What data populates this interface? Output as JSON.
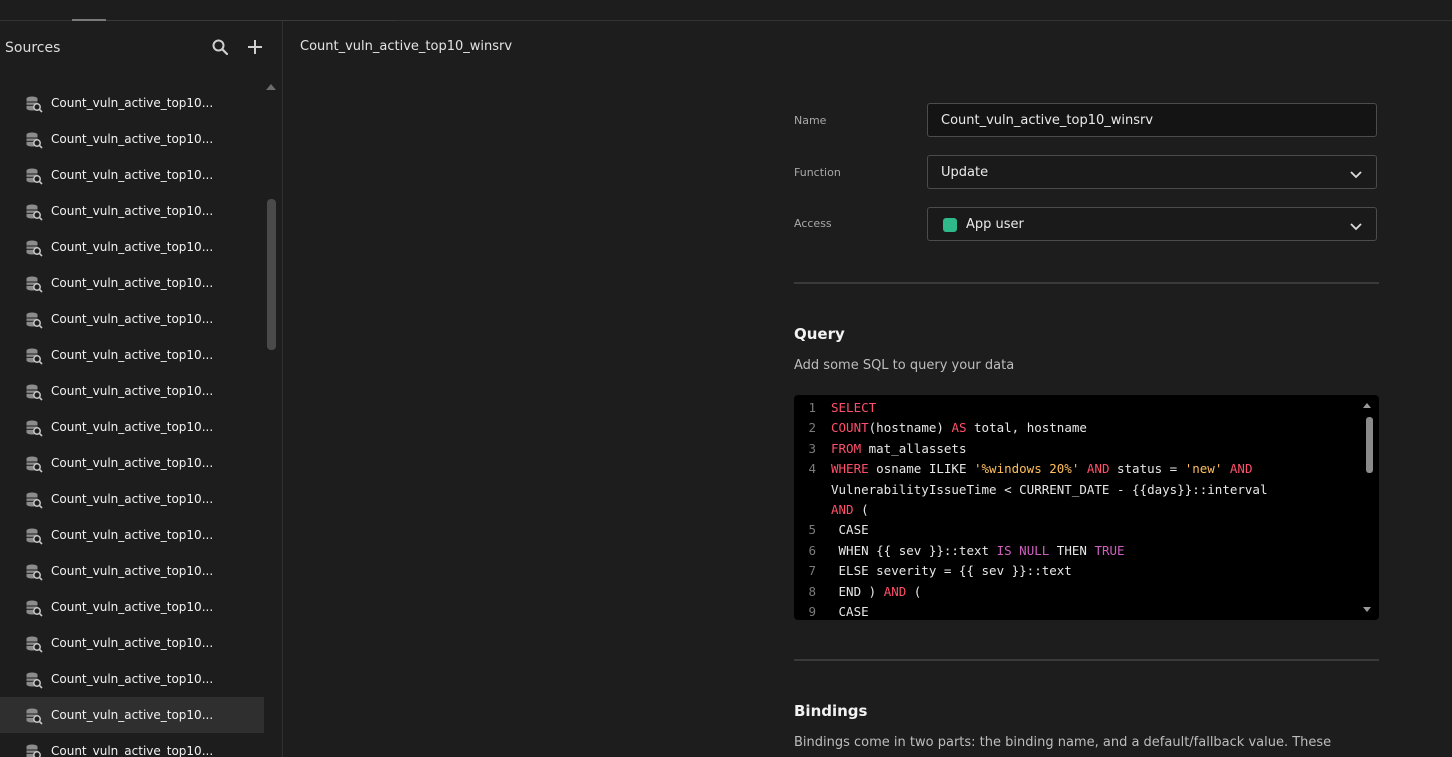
{
  "sidebar": {
    "title": "Sources",
    "search_icon": "search-icon",
    "add_icon": "plus-icon",
    "item_icon": "database-search-icon",
    "items": [
      {
        "label": "Count_vuln_active_top10..."
      },
      {
        "label": "Count_vuln_active_top10..."
      },
      {
        "label": "Count_vuln_active_top10..."
      },
      {
        "label": "Count_vuln_active_top10..."
      },
      {
        "label": "Count_vuln_active_top10..."
      },
      {
        "label": "Count_vuln_active_top10..."
      },
      {
        "label": "Count_vuln_active_top10..."
      },
      {
        "label": "Count_vuln_active_top10..."
      },
      {
        "label": "Count_vuln_active_top10..."
      },
      {
        "label": "Count_vuln_active_top10..."
      },
      {
        "label": "Count_vuln_active_top10..."
      },
      {
        "label": "Count_vuln_active_top10..."
      },
      {
        "label": "Count_vuln_active_top10..."
      },
      {
        "label": "Count_vuln_active_top10..."
      },
      {
        "label": "Count_vuln_active_top10..."
      },
      {
        "label": "Count_vuln_active_top10..."
      },
      {
        "label": "Count_vuln_active_top10..."
      },
      {
        "label": "Count_vuln_active_top10...",
        "selected": true
      },
      {
        "label": "Count_vuln_active_top10..."
      }
    ]
  },
  "header": {
    "title": "Count_vuln_active_top10_winsrv"
  },
  "form": {
    "name_label": "Name",
    "name_value": "Count_vuln_active_top10_winsrv",
    "function_label": "Function",
    "function_value": "Update",
    "access_label": "Access",
    "access_value": "App user",
    "access_color": "#2fb889"
  },
  "query": {
    "title": "Query",
    "description": "Add some SQL to query your data",
    "lines": [
      {
        "n": "1",
        "parts": [
          [
            "kw",
            "SELECT"
          ]
        ]
      },
      {
        "n": "2",
        "parts": [
          [
            "kw",
            "COUNT"
          ],
          [
            "",
            "(hostname) "
          ],
          [
            "kw",
            "AS"
          ],
          [
            "",
            " total, hostname"
          ]
        ]
      },
      {
        "n": "3",
        "parts": [
          [
            "kw",
            "FROM"
          ],
          [
            "",
            " mat_allassets"
          ]
        ]
      },
      {
        "n": "4",
        "parts": [
          [
            "kw",
            "WHERE"
          ],
          [
            "",
            " osname ILIKE "
          ],
          [
            "str",
            "'%windows 20%'"
          ],
          [
            "",
            " "
          ],
          [
            "kw",
            "AND"
          ],
          [
            "",
            " status = "
          ],
          [
            "str",
            "'new'"
          ],
          [
            "",
            " "
          ],
          [
            "kw",
            "AND"
          ]
        ]
      },
      {
        "n": "",
        "parts": [
          [
            "",
            "VulnerabilityIssueTime < CURRENT_DATE - {{days}}::interval"
          ]
        ]
      },
      {
        "n": "",
        "parts": [
          [
            "kw",
            "AND"
          ],
          [
            "",
            " ("
          ]
        ]
      },
      {
        "n": "5",
        "parts": [
          [
            "",
            " CASE"
          ]
        ]
      },
      {
        "n": "6",
        "parts": [
          [
            "",
            " WHEN {{ sev }}::text "
          ],
          [
            "kw2",
            "IS"
          ],
          [
            "",
            " "
          ],
          [
            "kw2",
            "NULL"
          ],
          [
            "",
            " THEN "
          ],
          [
            "kw2",
            "TRUE"
          ]
        ]
      },
      {
        "n": "7",
        "parts": [
          [
            "",
            " ELSE severity = {{ sev }}::text"
          ]
        ]
      },
      {
        "n": "8",
        "parts": [
          [
            "",
            " END ) "
          ],
          [
            "kw",
            "AND"
          ],
          [
            "",
            " ("
          ]
        ]
      },
      {
        "n": "9",
        "parts": [
          [
            "",
            " CASE"
          ]
        ]
      }
    ]
  },
  "bindings": {
    "title": "Bindings",
    "description": "Bindings come in two parts: the binding name, and a default/fallback value. These"
  }
}
